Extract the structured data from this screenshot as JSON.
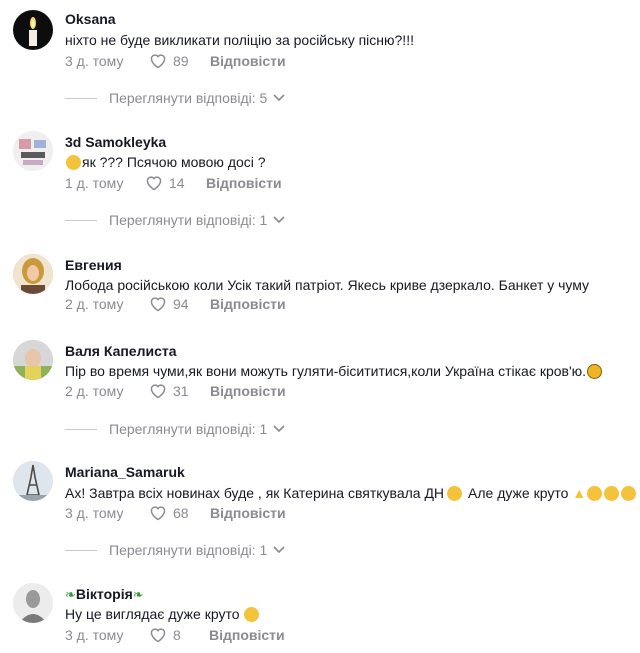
{
  "comments": [
    {
      "username": "Oksana",
      "text": "ніхто не буде викликати поліцію за російську пісню?!!!",
      "date": "3 д. тому",
      "likes": "89",
      "reply_label": "Відповісти",
      "view_replies": "Переглянути відповіді: 5",
      "avatar_icon": "candle-avatar"
    },
    {
      "username": "3d Samokleyka",
      "text": "як ??? Псячою мовою досі ?",
      "date": "1 д. тому",
      "likes": "14",
      "reply_label": "Відповісти",
      "view_replies": "Переглянути відповіді: 1",
      "avatar_icon": "sticker-avatar"
    },
    {
      "username": "Евгения",
      "text": "Лобода російською коли Усік такий патріот. Якесь криве дзеркало. Банкет у чуму",
      "date": "2 д. тому",
      "likes": "94",
      "reply_label": "Відповісти",
      "avatar_icon": "woman-avatar"
    },
    {
      "username": "Валя Капелиста",
      "text": "Пір во время чуми,як вони можуть гуляти-бісититися,коли Україна стікає кров'ю.",
      "date": "2 д. тому",
      "likes": "31",
      "reply_label": "Відповісти",
      "view_replies": "Переглянути відповіді: 1",
      "avatar_icon": "photo-avatar"
    },
    {
      "username": "Mariana_Samaruk",
      "text": "Ах! Завтра всіх новинах буде , як Катерина святкувала ДН",
      "text_after": "Але дуже круто",
      "date": "3 д. тому",
      "likes": "68",
      "reply_label": "Відповісти",
      "view_replies": "Переглянути відповіді: 1",
      "avatar_icon": "eiffel-tower-avatar"
    },
    {
      "username": "Вікторія",
      "text": "Ну це виглядає дуже круто",
      "date": "3 д. тому",
      "likes": "8",
      "reply_label": "Відповісти",
      "avatar_icon": "portrait-avatar"
    }
  ],
  "colors": {
    "text": "#161823",
    "muted": "#8a8b91",
    "accent_leaf": "#3a9a3a"
  }
}
